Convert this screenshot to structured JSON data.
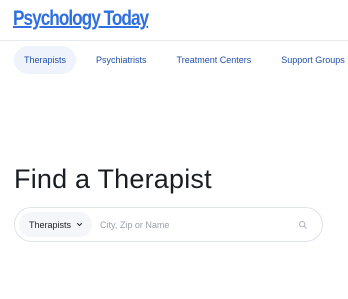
{
  "brand": {
    "logo_text": "Psychology Today",
    "color": "#2f6fe0"
  },
  "nav": {
    "items": [
      {
        "label": "Therapists",
        "active": true
      },
      {
        "label": "Psychiatrists",
        "active": false
      },
      {
        "label": "Treatment Centers",
        "active": false
      },
      {
        "label": "Support Groups",
        "active": false
      }
    ]
  },
  "main": {
    "title": "Find a Therapist"
  },
  "search": {
    "type_selected": "Therapists",
    "placeholder": "City, Zip or Name",
    "value": ""
  },
  "icons": {
    "dropdown": "chevron-down-icon",
    "search": "search-icon"
  }
}
